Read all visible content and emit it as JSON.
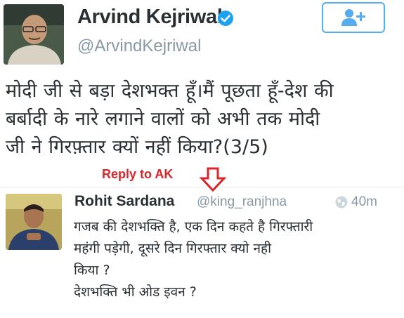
{
  "tweet": {
    "author_name": "Arvind Kejriwal",
    "author_handle": "@ArvindKejriwal",
    "text_lines": [
      "मोदी जी से बड़ा देशभक्त हूँ।मैं पूछता हूँ-देश की",
      "बर्बादी के नारे लगाने वालों को अभी तक मोदी",
      "जी ने गिरफ़्तार क्यों नहीं किया?(3/5)"
    ],
    "follow_icon": "add-user-icon",
    "verified_icon": "verified-badge-icon",
    "colors": {
      "accent": "#55acee",
      "name": "#292f33",
      "handle": "#8899a6"
    }
  },
  "annotation": {
    "label": "Reply to AK",
    "arrow_icon": "down-arrow-icon",
    "color": "#d9262b"
  },
  "reply": {
    "author_name": "Rohit Sardana",
    "author_handle": "@king_ranjhna",
    "time": "40m",
    "globe_icon": "globe-icon",
    "text_lines": [
      "गजब की देशभक्ति है, एक दिन कहते है गिरफ्तारी",
      "महंगी पड़ेगी, दूसरे दिन गिरफ्तार क्यो नही",
      "किया ?",
      "देशभक्ति भी ओड इवन ?"
    ]
  }
}
